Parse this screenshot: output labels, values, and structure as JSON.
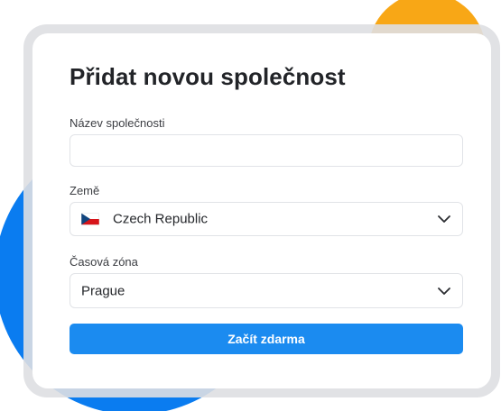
{
  "form": {
    "title": "Přidat novou společnost",
    "company_name": {
      "label": "Název společnosti",
      "value": "",
      "placeholder": ""
    },
    "country": {
      "label": "Země",
      "selected": "Czech Republic",
      "flag_icon": "czech-flag-icon"
    },
    "timezone": {
      "label": "Časová zóna",
      "selected": "Prague"
    },
    "submit_label": "Začít zdarma"
  },
  "colors": {
    "accent": "#1B8BF0",
    "blob_orange": "#F8A716",
    "blob_blue": "#0A7CF0",
    "card_border": "#DEDFE2"
  }
}
